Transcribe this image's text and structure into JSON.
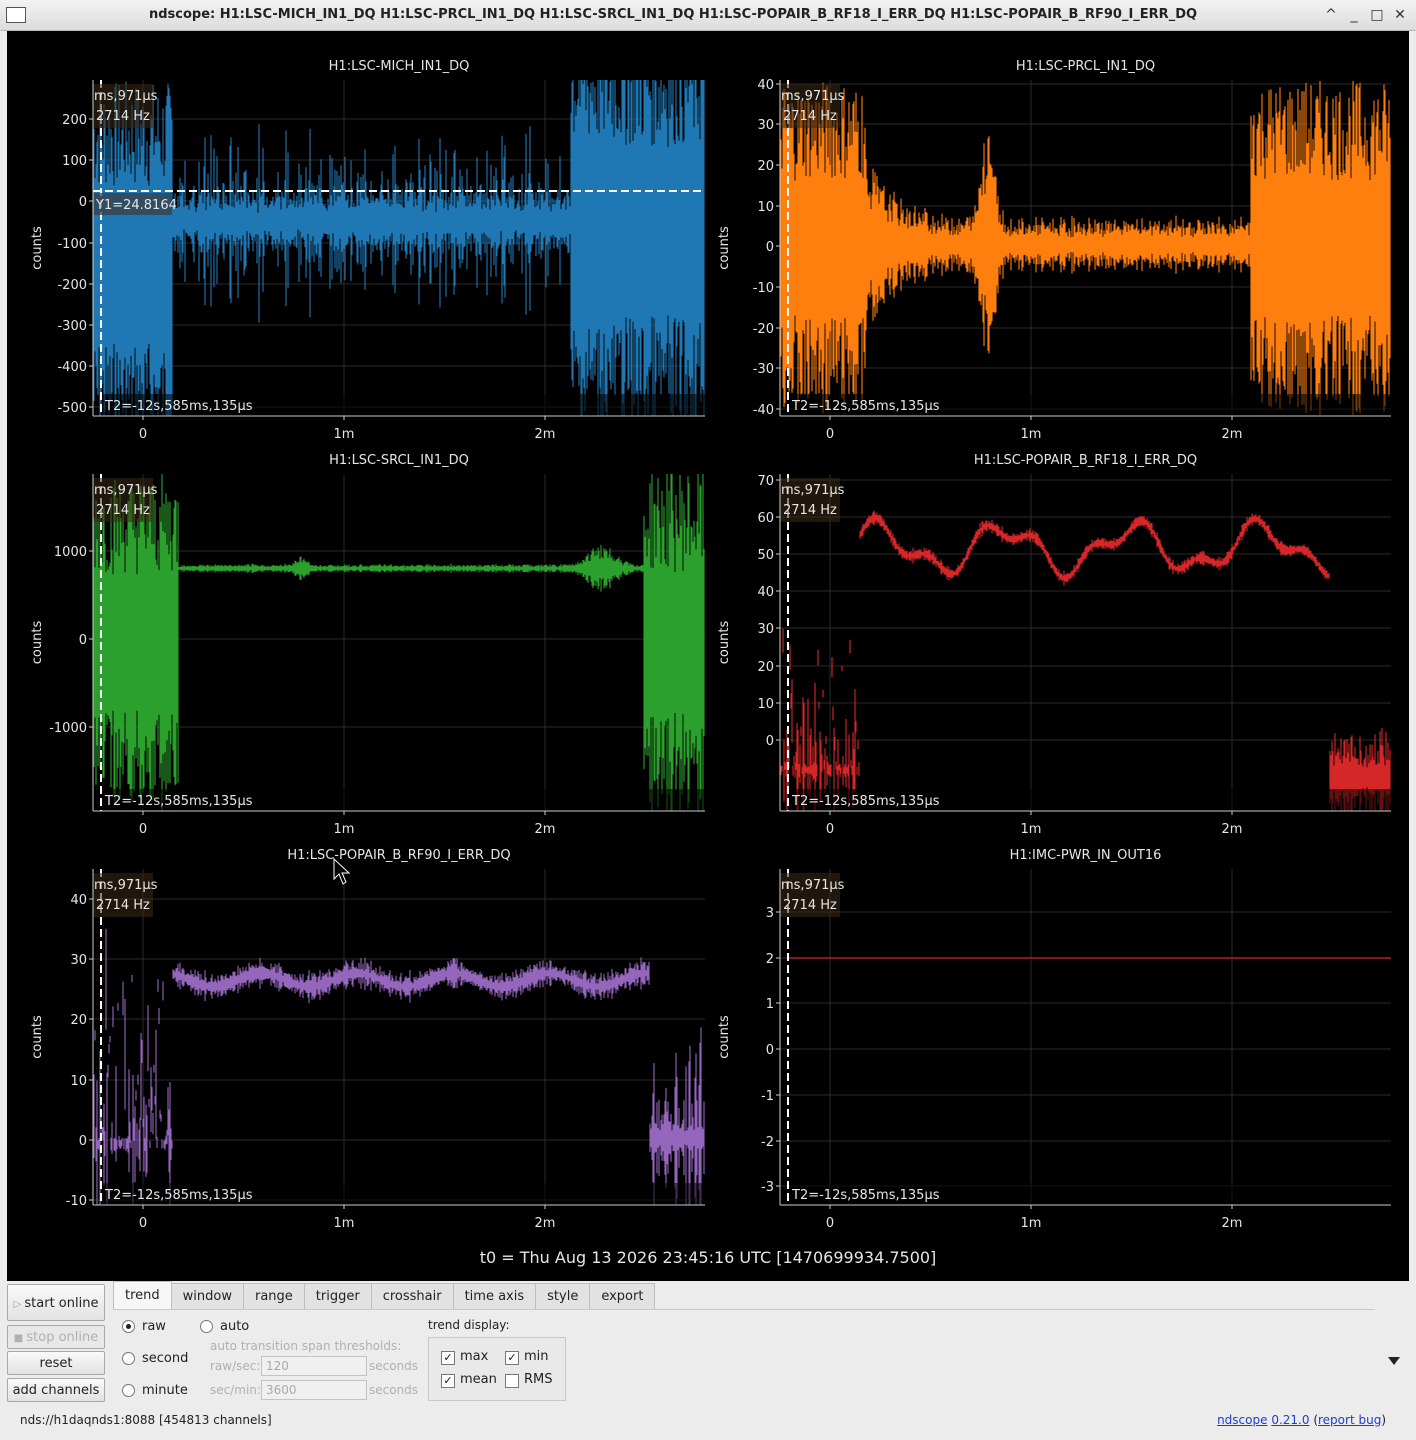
{
  "window": {
    "title": "ndscope: H1:LSC-MICH_IN1_DQ H1:LSC-PRCL_IN1_DQ H1:LSC-SRCL_IN1_DQ H1:LSC-POPAIR_B_RF18_I_ERR_DQ H1:LSC-POPAIR_B_RF90_I_ERR_DQ",
    "buttons": [
      "^",
      "_",
      "□",
      "✕"
    ]
  },
  "plots": [
    {
      "channel": "H1:LSC-MICH_IN1_DQ",
      "ylabel": "counts",
      "color": "#1f77b4",
      "yticks": [
        "200",
        "100",
        "0",
        "-100",
        "-200",
        "-300",
        "-400",
        "-500"
      ],
      "cursor_top": "ms,971µs",
      "cursor_freq": "2714 Hz",
      "cursor_y": "Y1=24.8164",
      "cursor_t": "T2=-12s,585ms,135µs"
    },
    {
      "channel": "H1:LSC-PRCL_IN1_DQ",
      "ylabel": "counts",
      "color": "#ff7f0e",
      "yticks": [
        "40",
        "30",
        "20",
        "10",
        "0",
        "-10",
        "-20",
        "-30",
        "-40"
      ],
      "cursor_top": "ms,971µs",
      "cursor_freq": "2714 Hz",
      "cursor_t": "T2=-12s,585ms,135µs"
    },
    {
      "channel": "H1:LSC-SRCL_IN1_DQ",
      "ylabel": "counts",
      "color": "#2ca02c",
      "yticks": [
        "1000",
        "0",
        "-1000"
      ],
      "cursor_top": "ms,971µs",
      "cursor_freq": "2714 Hz",
      "cursor_t": "T2=-12s,585ms,135µs"
    },
    {
      "channel": "H1:LSC-POPAIR_B_RF18_I_ERR_DQ",
      "ylabel": "counts",
      "color": "#d62728",
      "yticks": [
        "70",
        "60",
        "50",
        "40",
        "30",
        "20",
        "10",
        "0"
      ],
      "cursor_top": "ms,971µs",
      "cursor_freq": "2714 Hz",
      "cursor_t": "T2=-12s,585ms,135µs"
    },
    {
      "channel": "H1:LSC-POPAIR_B_RF90_I_ERR_DQ",
      "ylabel": "counts",
      "color": "#9467bd",
      "yticks": [
        "40",
        "30",
        "20",
        "10",
        "0",
        "-10"
      ],
      "cursor_top": "ms,971µs",
      "cursor_freq": "2714 Hz",
      "cursor_t": "T2=-12s,585ms,135µs"
    },
    {
      "channel": "H1:IMC-PWR_IN_OUT16",
      "ylabel": "counts",
      "color": "#d62728",
      "yticks": [
        "3",
        "2",
        "1",
        "0",
        "-1",
        "-2",
        "-3"
      ],
      "cursor_top": "ms,971µs",
      "cursor_freq": "2714 Hz",
      "cursor_t": "T2=-12s,585ms,135µs"
    }
  ],
  "xticks": [
    "0",
    "1m",
    "2m"
  ],
  "t0_label": "t0 = Thu Aug 13 2026 23:45:16 UTC [1470699934.7500]",
  "sidebar": {
    "start_online": "start online",
    "stop_online": "stop online",
    "reset": "reset",
    "add_channels": "add channels"
  },
  "tabs": [
    "trend",
    "window",
    "range",
    "trigger",
    "crosshair",
    "time axis",
    "style",
    "export"
  ],
  "trend": {
    "raw": "raw",
    "second": "second",
    "minute": "minute",
    "auto": "auto",
    "auto_heading": "auto transition span thresholds:",
    "raw_sec_label": "raw/sec:",
    "raw_sec_value": "120",
    "sec_min_label": "sec/min:",
    "sec_min_value": "3600",
    "seconds": "seconds",
    "display_heading": "trend display:",
    "max": "max",
    "min": "min",
    "mean": "mean",
    "rms": "RMS",
    "max_checked": true,
    "min_checked": true,
    "mean_checked": true,
    "rms_checked": false,
    "selected_mode": "raw"
  },
  "status": {
    "server": "nds://h1daqnds1:8088  [454813 channels]",
    "app_name": "ndscope",
    "version": "0.21.0",
    "report_bug": "report bug"
  }
}
